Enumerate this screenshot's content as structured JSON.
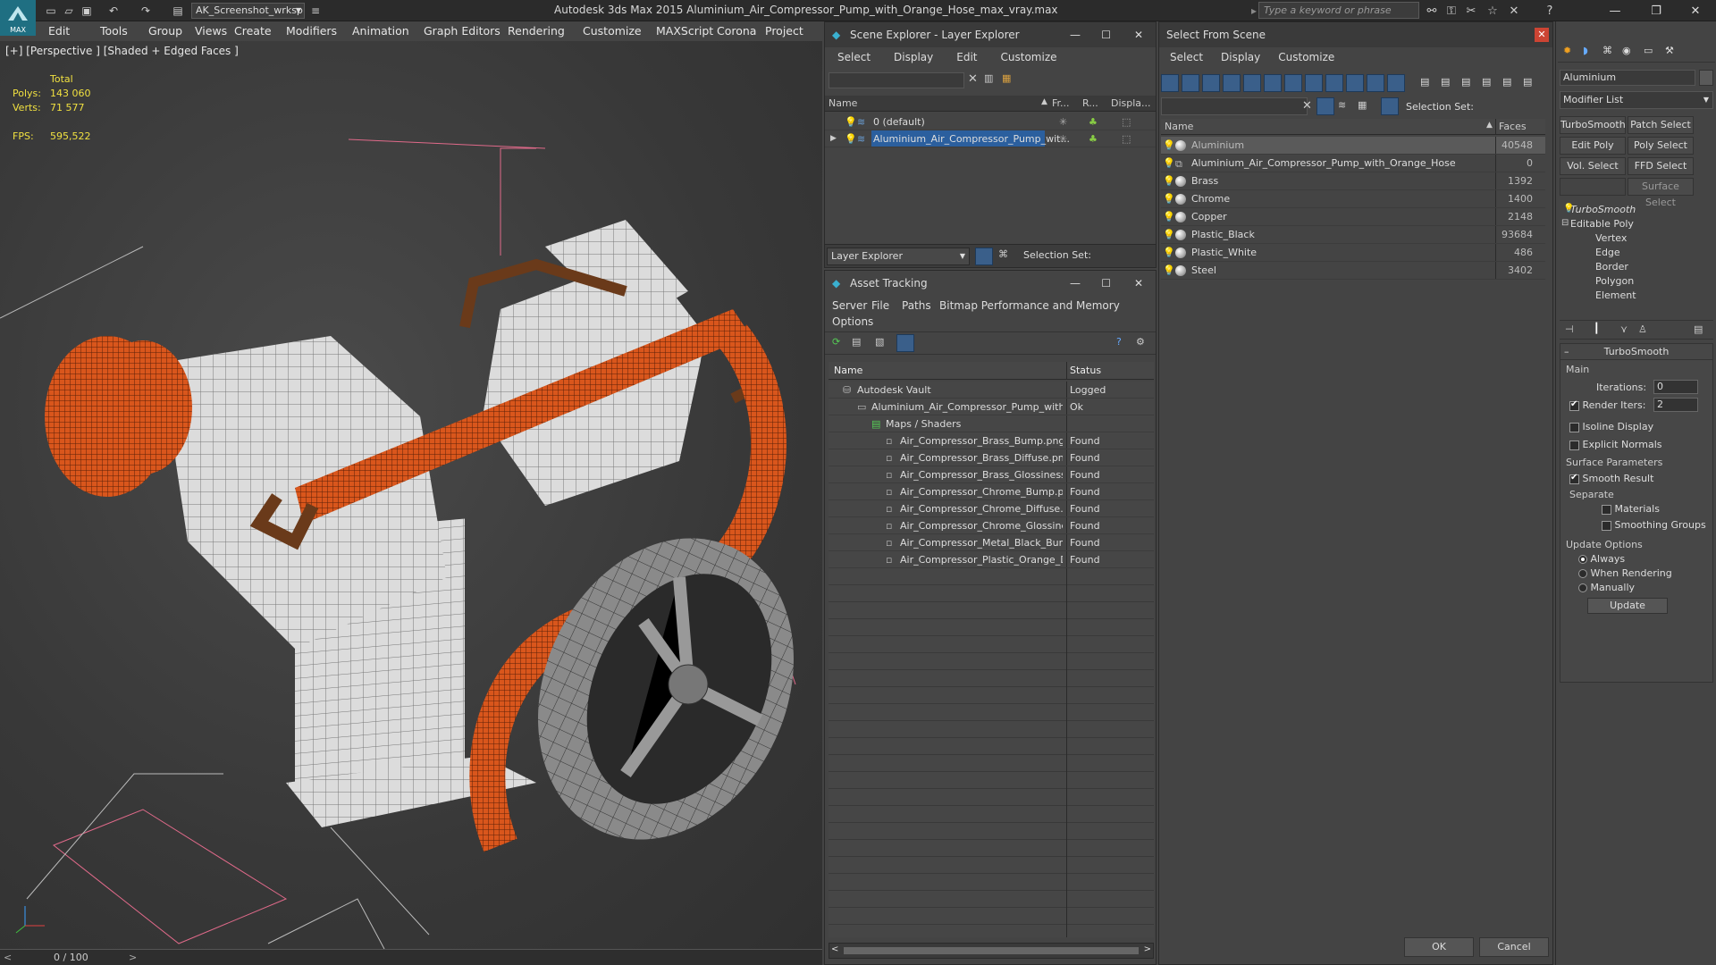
{
  "app": {
    "title": "Autodesk 3ds Max 2015    Aluminium_Air_Compressor_Pump_with_Orange_Hose_max_vray.max",
    "logo_text": "MAX",
    "workspace": "AK_Screenshot_wrksp",
    "search_placeholder": "Type a keyword or phrase"
  },
  "menubar": [
    "Edit",
    "Tools",
    "Group",
    "Views",
    "Create",
    "Modifiers",
    "Animation",
    "Graph Editors",
    "Rendering",
    "Customize",
    "MAXScript",
    "Corona",
    "Project Man"
  ],
  "viewport": {
    "label": "[+] [Perspective ] [Shaded + Edged Faces ]",
    "stats": {
      "total_label": "Total",
      "polys_label": "Polys:",
      "polys": "143 060",
      "verts_label": "Verts:",
      "verts": "71 577",
      "fps_label": "FPS:",
      "fps": "595,522"
    },
    "timeline": "0 / 100"
  },
  "scene_explorer": {
    "title": "Scene Explorer - Layer Explorer",
    "menu": [
      "Select",
      "Display",
      "Edit",
      "Customize"
    ],
    "columns": [
      "Name",
      "Fr...",
      "R...",
      "Displa..."
    ],
    "rows": [
      {
        "name": "0 (default)",
        "selected": false
      },
      {
        "name": "Aluminium_Air_Compressor_Pump_wit...",
        "selected": true
      }
    ],
    "footer_dropdown": "Layer Explorer",
    "selection_set_label": "Selection Set:"
  },
  "asset_tracking": {
    "title": "Asset Tracking",
    "menu": [
      "Server",
      "File",
      "Paths",
      "Bitmap Performance and Memory",
      "Options"
    ],
    "columns": [
      "Name",
      "Status"
    ],
    "rows": [
      {
        "name": "Autodesk Vault",
        "status": "Logged",
        "indent": 1
      },
      {
        "name": "Aluminium_Air_Compressor_Pump_with_Orang...",
        "status": "Ok",
        "indent": 2
      },
      {
        "name": "Maps / Shaders",
        "status": "",
        "indent": 3
      },
      {
        "name": "Air_Compressor_Brass_Bump.png",
        "status": "Found",
        "indent": 4
      },
      {
        "name": "Air_Compressor_Brass_Diffuse.png",
        "status": "Found",
        "indent": 4
      },
      {
        "name": "Air_Compressor_Brass_Glossiness.png",
        "status": "Found",
        "indent": 4
      },
      {
        "name": "Air_Compressor_Chrome_Bump.png",
        "status": "Found",
        "indent": 4
      },
      {
        "name": "Air_Compressor_Chrome_Diffuse.png",
        "status": "Found",
        "indent": 4
      },
      {
        "name": "Air_Compressor_Chrome_Glossiness.png",
        "status": "Found",
        "indent": 4
      },
      {
        "name": "Air_Compressor_Metal_Black_Bump.png",
        "status": "Found",
        "indent": 4
      },
      {
        "name": "Air_Compressor_Plastic_Orange_Diffuse.p...",
        "status": "Found",
        "indent": 4
      }
    ]
  },
  "select_from_scene": {
    "title": "Select From Scene",
    "menu": [
      "Select",
      "Display",
      "Customize"
    ],
    "selection_set_label": "Selection Set:",
    "columns": [
      "Name",
      "Faces"
    ],
    "rows": [
      {
        "name": "Aluminium",
        "faces": "40548",
        "selected": true,
        "icon": "sphere"
      },
      {
        "name": "Aluminium_Air_Compressor_Pump_with_Orange_Hose",
        "faces": "0",
        "selected": false,
        "icon": "group"
      },
      {
        "name": "Brass",
        "faces": "1392",
        "selected": false,
        "icon": "sphere"
      },
      {
        "name": "Chrome",
        "faces": "1400",
        "selected": false,
        "icon": "sphere"
      },
      {
        "name": "Copper",
        "faces": "2148",
        "selected": false,
        "icon": "sphere"
      },
      {
        "name": "Plastic_Black",
        "faces": "93684",
        "selected": false,
        "icon": "sphere"
      },
      {
        "name": "Plastic_White",
        "faces": "486",
        "selected": false,
        "icon": "sphere"
      },
      {
        "name": "Steel",
        "faces": "3402",
        "selected": false,
        "icon": "sphere"
      }
    ],
    "ok": "OK",
    "cancel": "Cancel"
  },
  "command_panel": {
    "object_name": "Aluminium",
    "modifier_list": "Modifier List",
    "buttons": [
      "TurboSmooth",
      "Patch Select",
      "Edit Poly",
      "Poly Select",
      "Vol. Select",
      "FFD Select",
      "",
      "Surface Select"
    ],
    "stack": [
      {
        "label": "TurboSmooth",
        "level": 0,
        "italic": true
      },
      {
        "label": "Editable Poly",
        "level": 0,
        "italic": false
      },
      {
        "label": "Vertex",
        "level": 1
      },
      {
        "label": "Edge",
        "level": 1
      },
      {
        "label": "Border",
        "level": 1
      },
      {
        "label": "Polygon",
        "level": 1
      },
      {
        "label": "Element",
        "level": 1
      }
    ],
    "rollout": {
      "title": "TurboSmooth",
      "main": "Main",
      "iterations_label": "Iterations:",
      "iterations": "0",
      "render_iters_label": "Render Iters:",
      "render_iters": "2",
      "isoline": "Isoline Display",
      "explicit": "Explicit Normals",
      "surface_params": "Surface Parameters",
      "smooth_result": "Smooth Result",
      "separate": "Separate",
      "materials": "Materials",
      "smoothing_groups": "Smoothing Groups",
      "update_options": "Update Options",
      "always": "Always",
      "when_rendering": "When Rendering",
      "manually": "Manually",
      "update": "Update"
    }
  },
  "colors": {
    "accent": "#1f6f82",
    "selection": "#2b5f9e",
    "orange": "#e0531a"
  }
}
